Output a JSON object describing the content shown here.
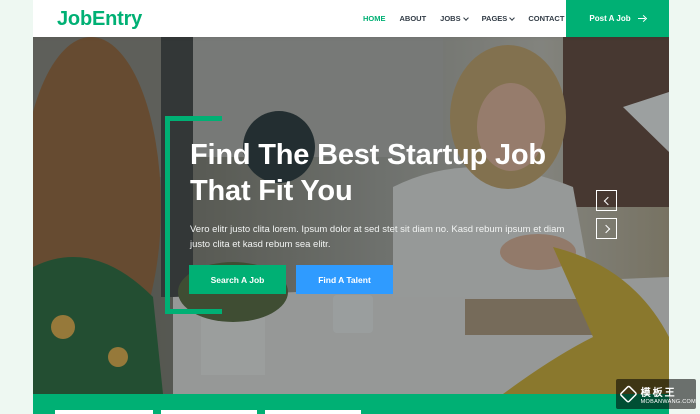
{
  "brand": {
    "name": "JobEntry",
    "color": "#00b074",
    "talent_color": "#2f9bff"
  },
  "nav": {
    "items": [
      {
        "label": "HOME",
        "active": true,
        "dropdown": false
      },
      {
        "label": "ABOUT",
        "active": false,
        "dropdown": false
      },
      {
        "label": "JOBS",
        "active": false,
        "dropdown": true
      },
      {
        "label": "PAGES",
        "active": false,
        "dropdown": true
      },
      {
        "label": "CONTACT",
        "active": false,
        "dropdown": false
      }
    ],
    "cta_label": "Post A Job",
    "cta_icon": "arrow-right-icon"
  },
  "hero": {
    "headline_line1": "Find The Best Startup Job",
    "headline_line2": "That Fit You",
    "subtext": "Vero elitr justo clita lorem. Ipsum dolor at sed stet sit diam no. Kasd rebum ipsum et diam justo clita et kasd rebum sea elitr.",
    "primary_button": "Search A Job",
    "secondary_button": "Find A Talent",
    "prev_icon": "chevron-left-icon",
    "next_icon": "chevron-right-icon"
  },
  "watermark": {
    "cn": "模板王",
    "en": "MOBANWANG.COM"
  }
}
